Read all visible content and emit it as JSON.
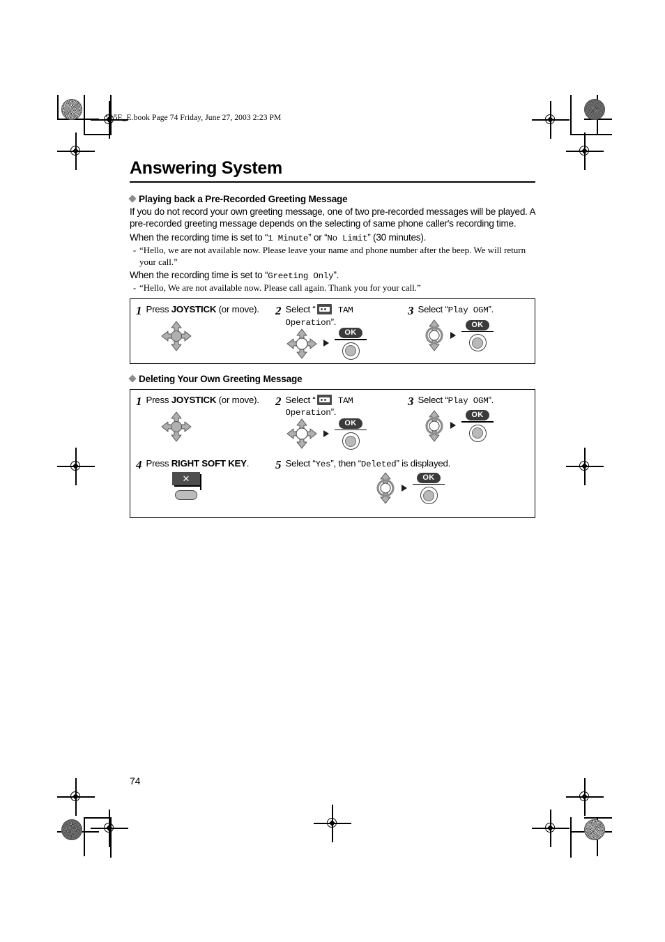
{
  "header": {
    "file_meta": "515E_E.book  Page 74  Friday, June 27, 2003  2:23 PM"
  },
  "page": {
    "title": "Answering System",
    "page_number": "74"
  },
  "sections": [
    {
      "heading": "Playing back a Pre-Recorded Greeting Message",
      "paragraphs": [
        "If you do not record your own greeting message, one of two pre-recorded messages will be played. A pre-recorded greeting message depends on the selecting of same phone caller's recording time.",
        "When the recording time is set to “1 Minute” or “No Limit” (30 minutes).",
        "“Hello, we are not available now. Please leave your name and phone number after the beep. We will return your call.”",
        "When the recording time is set to “Greeting Only”.",
        "“Hello, We are not available now. Please call again. Thank you  for your call.”"
      ],
      "inline": {
        "rec_line1_pre": "When the recording time is set to “",
        "rec_line1_mono1": "1 Minute",
        "rec_line1_mid": "” or “",
        "rec_line1_mono2": "No Limit",
        "rec_line1_post": "” (30 minutes).",
        "rec_line2_pre": "When the recording time is set to “",
        "rec_line2_mono": "Greeting Only",
        "rec_line2_post": "”.",
        "dash": "-",
        "quote1": "“Hello, we are not available now. Please leave your name and phone number after the beep. We will return your call.”",
        "quote2": "“Hello, We are not available now. Please call again. Thank you  for your call.”"
      }
    },
    {
      "heading": "Deleting Your Own Greeting Message"
    }
  ],
  "box1": {
    "steps": [
      {
        "num": "1",
        "text_pre": "Press ",
        "text_bold": "JOYSTICK",
        "text_post": " (or move).",
        "icon": "joystick-4way"
      },
      {
        "num": "2",
        "text_pre": "Select “",
        "icon_inline": "tam-cassette-icon",
        "text_mono": " TAM Operation",
        "text_post": "”.",
        "icon": "joystick-4way",
        "arrow": "▶",
        "ok_label": "OK"
      },
      {
        "num": "3",
        "text_pre": "Select “",
        "text_mono": "Play OGM",
        "text_post": "”.",
        "icon": "joystick-2way",
        "arrow": "▶",
        "ok_label": "OK"
      }
    ]
  },
  "box2": {
    "steps": [
      {
        "num": "1",
        "text_pre": "Press ",
        "text_bold": "JOYSTICK",
        "text_post": " (or move).",
        "icon": "joystick-4way"
      },
      {
        "num": "2",
        "text_pre": "Select “",
        "icon_inline": "tam-cassette-icon",
        "text_mono": " TAM Operation",
        "text_post": "”.",
        "icon": "joystick-4way",
        "arrow": "▶",
        "ok_label": "OK"
      },
      {
        "num": "3",
        "text_pre": "Select “",
        "text_mono": "Play OGM",
        "text_post": "”.",
        "icon": "joystick-2way",
        "arrow": "▶",
        "ok_label": "OK"
      },
      {
        "num": "4",
        "text_pre": "Press ",
        "text_bold": "RIGHT SOFT KEY",
        "text_post": ".",
        "icon": "right-soft-key",
        "softkey_glyph": "✕"
      },
      {
        "num": "5",
        "text_pre": "Select “",
        "text_mono": "Yes",
        "text_mid": "”, then “",
        "text_mono2": "Deleted",
        "text_post": "” is displayed.",
        "icon": "joystick-2way",
        "arrow": "▶",
        "ok_label": "OK"
      }
    ]
  },
  "colors": {
    "rule": "#000000",
    "diamond": "#8b8b8b",
    "icon_dark": "#4a4a4a",
    "icon_gray": "#b9b9b9"
  }
}
